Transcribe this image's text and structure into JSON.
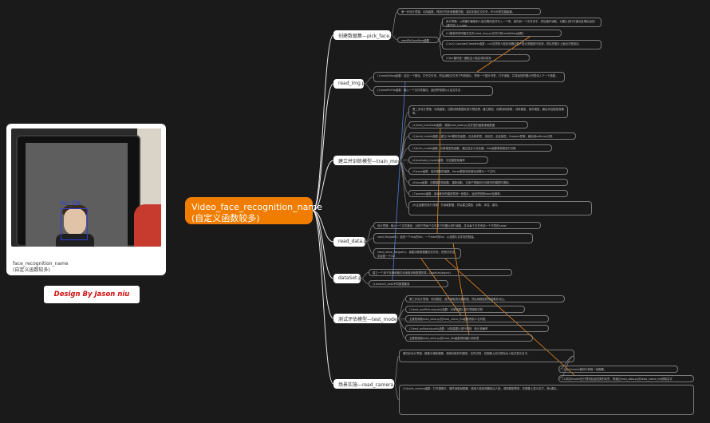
{
  "center": {
    "line1": "Video_face_recognition_name",
    "line2": "(自定义函数较多)"
  },
  "photo": {
    "box_label": "hu_Qe",
    "caption_line1": "face_recognition_name",
    "caption_line2": "(自定义函数较多)"
  },
  "design_label": "Design By Jason niu",
  "branches": {
    "pick_face": "创建数据集—pick_face.py",
    "read_img": "read_img.py",
    "train_model": "建立并训练模型—train_model.py",
    "read_data": "read_data.py",
    "dataset": "dataSet.py",
    "test_model": "测试评估模型—test_model.py",
    "read_camera": "场景实施—read_camera.py"
  },
  "sub": {
    "readPicSaveFace": "readPicSaveFace函数"
  },
  "leaves": {
    "pf1": "第一步设计思路：利用函数，得到已知多张截图的脸，保存到指定文件夹，作为代表性模板集。",
    "pf2": "设计思路：从原图中截取到人脸位置信息并写入一个表，保存到一个文件夹中，然后循环读取，对图片进行灰度化处理后返回(格式如: 1 x.jpg)",
    "pf3": "(1)搜索所有同格式文件(read_img.py文件中的readAllImg函数)",
    "pf4": "(2)cv2.CascadeClassifier函数：cv2自带的人脸检测器加载人脸分类器进行检测，然后在图片上画出方框保存。",
    "pf5": "(3)for循环逐一截取出人脸区域并保存",
    "ri1": "(1)readAllImg函数：给定一个路径，打开文件夹，然后读取文件夹下所有图片，得到一个图片列表，打开读取，并将返回的图片列表传入下一个函数。",
    "ri2": "(2)readPicFile函数：输入一个文件夹路径，返回所有图片以及文件名",
    "tm1": "第二步设计思路：利用函数，加载训练数据并进行预处理，建立模型，设置训练参数，训练模型，保存模型，最后评估模型准确率。",
    "tm2": "(1)read_trainData函数：调用read_data.py文件里的函数读取数据",
    "tm3": "(2)build_model函数：建立CNN模型的函数，包含卷积层、池化层、全连接层、Dropout层等，最后用softmax分类",
    "tm4": "(3)train_model函数：训练模型的函数，通过自定义优化器，loss函数等参数进行训练",
    "tm5": "(4)evaluate_model函数：评估模型准确率",
    "tm6": "(5)save函数：保存模型的函数，Keras模型保存路径设置为一个文件。",
    "tm7": "(6)load函数：加载模型的函数，重新读取，当用户想使用已训练好的模型时调用。",
    "tm8": "(7)predict函数：用训练好的模型预测一张图片，返回预测的label及概率。",
    "tm9": "(8)主函数的执行流程：先读取数据，然后建立模型、训练、评估、保存。",
    "rd1": "设计思路：输入一个文件路径，对其下的每个文件夹下的图片进行读取，并对每个文件夹给一个不同的Label",
    "rd2": "read_file(path)：返回一个img的list，一个label的list，以及图片文件夹的数量。",
    "rd3": "read_name_list(path)：读取训练数据集的文件夹，把他们的名字返回一个list",
    "ds1": "建立一个用于存储和格式化读取训练数据的类—DataSet(object)",
    "ds2": "(1)extract_data不同数据集类",
    "tt1": "第三步设计思路：测试模型，首先读取测试集数据，然后用模型预测结果并对比。",
    "tt2": "(1)test_onePicture(path)函数：对单张图片进行预测和识别",
    "tt3": "主要是调用read_data.py的read_name_list函数得到人名列表。",
    "tt4": "(2)test_onBatch(path)函数：对批量图片进行预测，统计准确率",
    "tt5": "主要是调用read_data.py的read_file函数得到图片和标签",
    "rc1": "第四步设计思路：摄像头捕获图像，调用训练好的模型，实时识别，在图像上用方框标出人脸并显示名字。",
    "rc2": "(1)从Camera模块中获取一帧图像。",
    "rc3": "(2)利用model进行预测后返回类别标签，再通过read_data.py的read_name_list获取名字",
    "rc4": "(3)build_camera函数：打开摄像头，循环读取帧图像，使用人脸检测器找出人脸，调用模型预测，在图像上显示名字，按q退出。"
  }
}
